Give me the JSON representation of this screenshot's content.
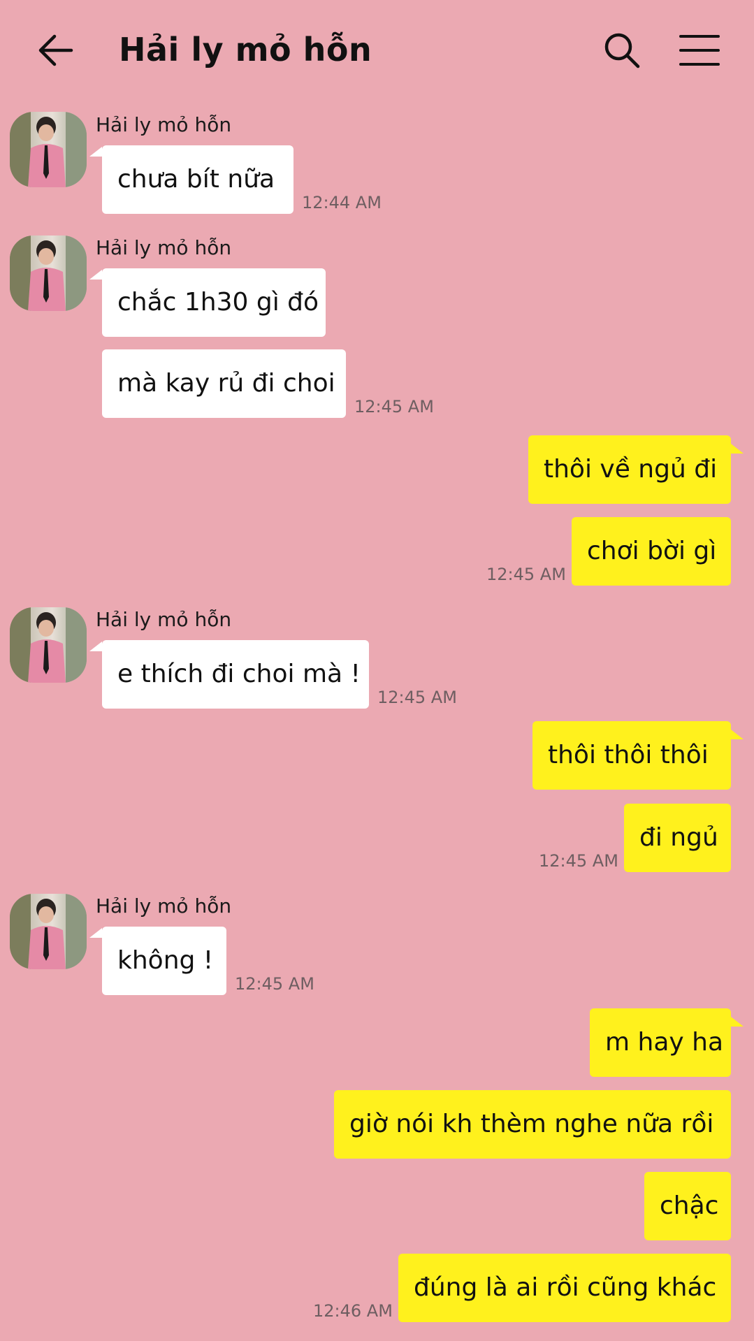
{
  "header": {
    "title": "Hải ly mỏ hỗn",
    "back_icon": "arrow-left-icon",
    "search_icon": "search-icon",
    "menu_icon": "hamburger-menu-icon"
  },
  "colors": {
    "background": "#eba9b2",
    "incoming_bubble": "#ffffff",
    "outgoing_bubble": "#fff11d",
    "timestamp": "#6e5e61"
  },
  "messages": [
    {
      "sender": "Hải ly mỏ hỗn",
      "text": "chưa bít nữa",
      "time": "12:44 AM"
    },
    {
      "sender": "Hải ly mỏ hỗn",
      "text": "chắc 1h30 gì đó"
    },
    {
      "text": "mà kay rủ đi choi",
      "time": "12:45 AM"
    },
    {
      "text": "thôi về ngủ đi"
    },
    {
      "text": "chơi bời gì",
      "time": "12:45 AM"
    },
    {
      "sender": "Hải ly mỏ hỗn",
      "text": "e thích đi choi mà !",
      "time": "12:45 AM"
    },
    {
      "text": "thôi thôi thôi"
    },
    {
      "text": "đi ngủ",
      "time": "12:45 AM"
    },
    {
      "sender": "Hải ly mỏ hỗn",
      "text": "không !",
      "time": "12:45 AM"
    },
    {
      "text": "m hay ha"
    },
    {
      "text": "giờ nói kh thèm nghe nữa rồi"
    },
    {
      "text": "chậc"
    },
    {
      "text": "đúng là ai rồi cũng khác",
      "time": "12:46 AM"
    }
  ]
}
